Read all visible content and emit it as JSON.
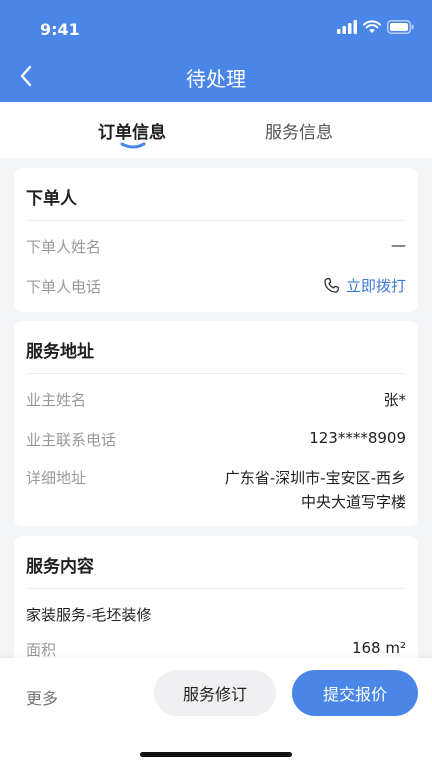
{
  "status_bar": {
    "time": "9:41"
  },
  "header": {
    "title": "待处理"
  },
  "tabs": [
    {
      "label": "订单信息",
      "active": true
    },
    {
      "label": "服务信息",
      "active": false
    }
  ],
  "orderer_card": {
    "title": "下单人",
    "name_label": "下单人姓名",
    "name_value": "—",
    "phone_label": "下单人电话",
    "call_label": "立即拨打"
  },
  "address_card": {
    "title": "服务地址",
    "owner_name_label": "业主姓名",
    "owner_name_value": "张*",
    "owner_phone_label": "业主联系电话",
    "owner_phone_value": "123****8909",
    "address_label": "详细地址",
    "address_line1": "广东省-深圳市-宝安区-西乡",
    "address_line2": "中央大道写字楼"
  },
  "service_card": {
    "title": "服务内容",
    "service_name": "家装服务-毛坯装修",
    "area_label": "面积",
    "area_value": "168 m²"
  },
  "bottom_bar": {
    "more_label": "更多",
    "revise_label": "服务修订",
    "submit_label": "提交报价"
  },
  "colors": {
    "brand": "#4a86e8",
    "link": "#3b78d8"
  }
}
